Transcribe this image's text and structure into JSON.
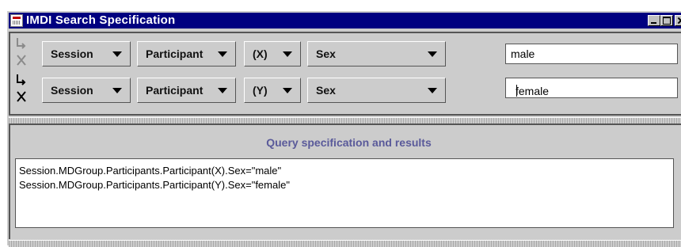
{
  "window": {
    "title": "IMDI Search Specification"
  },
  "query_rows": [
    {
      "scope": "Session",
      "group": "Participant",
      "variable": "(X)",
      "field": "Sex",
      "value": "male"
    },
    {
      "scope": "Session",
      "group": "Participant",
      "variable": "(Y)",
      "field": "Sex",
      "value": "female"
    }
  ],
  "results": {
    "title": "Query specification and results",
    "lines": [
      "Session.MDGroup.Participants.Participant(X).Sex=\"male\"",
      "Session.MDGroup.Participants.Participant(Y).Sex=\"female\""
    ]
  },
  "colors": {
    "titlebar": "#000080",
    "panel": "#cccccc",
    "results_title": "#5a5a9a"
  }
}
